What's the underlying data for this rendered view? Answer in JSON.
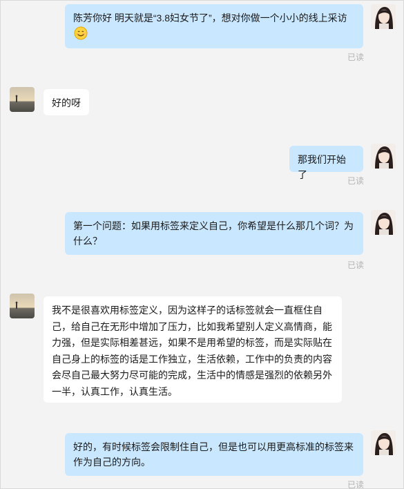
{
  "chat": {
    "read_label": "已读",
    "messages": [
      {
        "from": "me",
        "text": "陈芳你好  明天就是“3.8妇女节了”，想对你做一个小小的线上采访",
        "emoji": "smile-emoji"
      },
      {
        "from": "them",
        "text": "好的呀"
      },
      {
        "from": "me",
        "text": "那我们开始了"
      },
      {
        "from": "me",
        "text": "第一个问题：如果用标签来定义自己，你希望是什么那几个词？为什么？"
      },
      {
        "from": "them",
        "text": "我不是很喜欢用标签定义，因为这样子的话标签就会一直框住自己，给自己在无形中增加了压力，比如我希望别人定义高情商，能力强，但是实际相差甚远，如果不是用希望的标签，而是实际贴在自己身上的标签的话是工作独立，生活依赖，工作中的负责的内容会尽自己最大努力尽可能的完成，生活中的情感是强烈的依赖另外一半，认真工作，认真生活。"
      },
      {
        "from": "me",
        "text": "好的，有时候标签会限制住自己，但是也可以用更高标准的标签来作为自己的方向。"
      }
    ]
  },
  "colors": {
    "my_bubble": "#c9e7ff",
    "their_bubble": "#ffffff",
    "background": "#f3f3f3"
  }
}
